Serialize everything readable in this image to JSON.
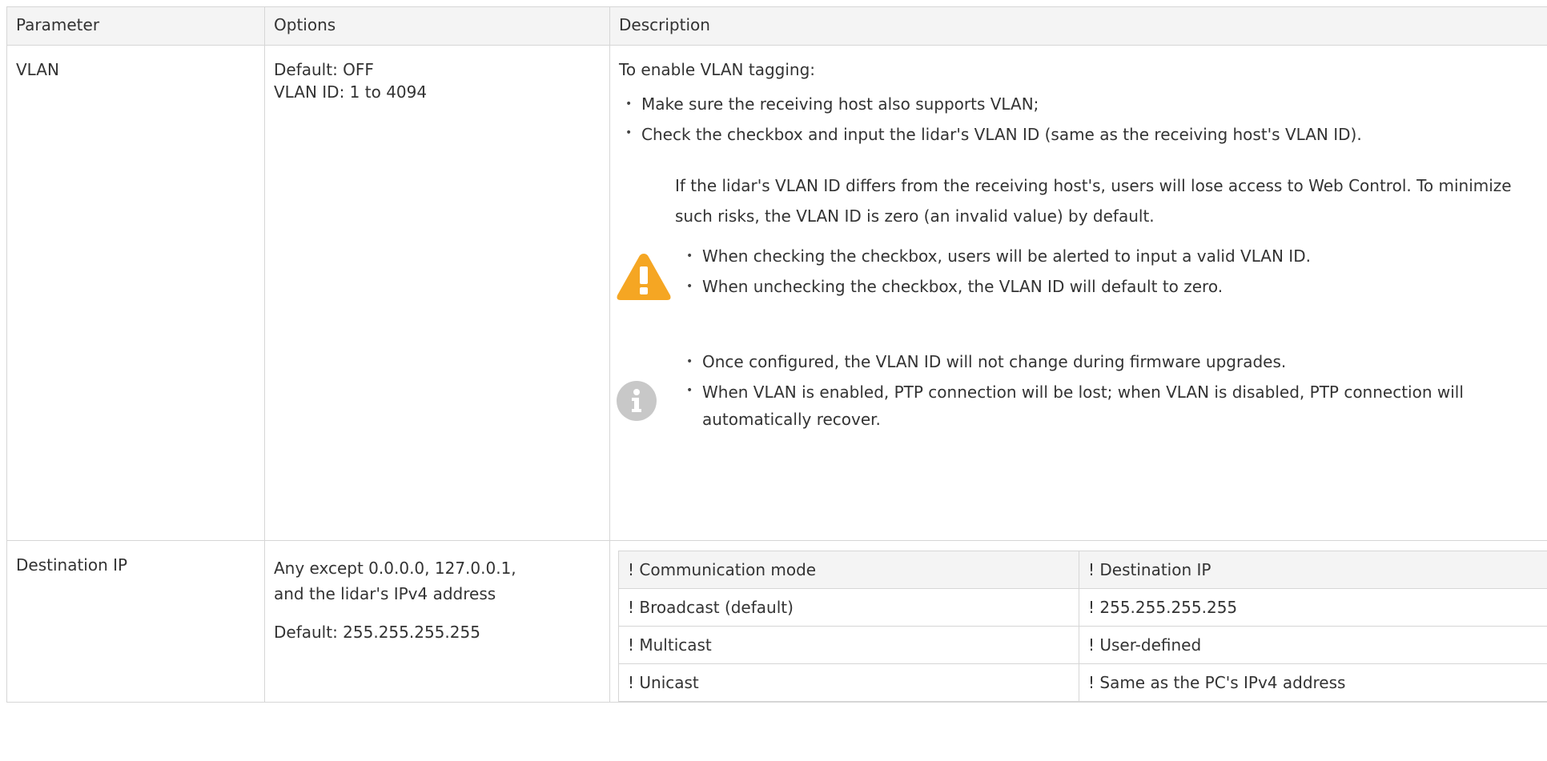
{
  "table": {
    "headers": [
      "Parameter",
      "Options",
      "Description"
    ],
    "vlan": {
      "parameter": "VLAN",
      "options": [
        "Default: OFF",
        "VLAN ID: 1 to 4094"
      ],
      "intro": "To enable VLAN tagging:",
      "steps": [
        "Make sure the receiving host also supports VLAN;",
        "Check the checkbox and input the lidar's VLAN ID (same as the receiving host's VLAN ID)."
      ],
      "warning": {
        "icon": "warning-icon",
        "text": "If the lidar's VLAN ID differs from the receiving host's, users will lose access to Web Control. To minimize such risks, the VLAN ID is zero (an invalid value) by default.",
        "bullets": [
          "When checking the checkbox, users will be alerted to input a valid VLAN ID.",
          "When unchecking the checkbox, the VLAN ID will default to zero."
        ]
      },
      "note": {
        "icon": "info-icon",
        "bullets": [
          "Once configured, the VLAN ID will not change during firmware upgrades.",
          "When VLAN is enabled, PTP connection will be lost; when VLAN is disabled, PTP connection will automatically recover."
        ]
      }
    },
    "destination_ip": {
      "parameter": "Destination IP",
      "options": [
        "Any except 0.0.0.0, 127.0.0.1,",
        "and the lidar's IPv4 address",
        "Default: 255.255.255.255"
      ],
      "mode_table": {
        "headers": [
          "! Communication mode",
          "! Destination IP"
        ],
        "rows": [
          [
            "! Broadcast (default)",
            "! 255.255.255.255"
          ],
          [
            "! Multicast",
            "! User-defined"
          ],
          [
            "! Unicast",
            "! Same as the PC's IPv4 address"
          ]
        ]
      }
    }
  },
  "colors": {
    "border": "#d6d6d6",
    "header_bg": "#f4f4f4",
    "warning": "#f5a623",
    "info": "#c8c8c8",
    "text": "#333333"
  }
}
